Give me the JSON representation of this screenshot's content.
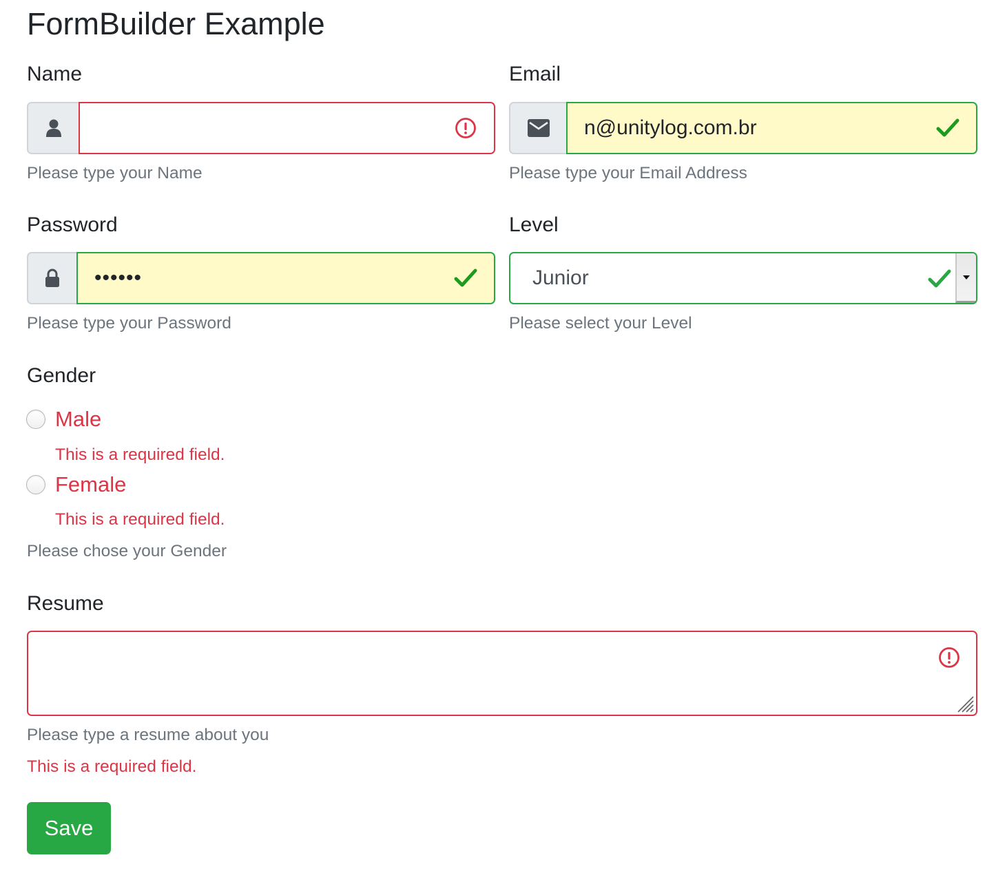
{
  "page": {
    "title": "FormBuilder Example"
  },
  "colors": {
    "valid": "#28a745",
    "invalid": "#dc3545",
    "valid_fill": "#fffac8",
    "help_text": "#6c757d",
    "primary_button": "#28a745"
  },
  "form": {
    "name": {
      "label": "Name",
      "value": "",
      "addon_icon": "user-icon",
      "status": "invalid",
      "status_icon": "exclamation-circle-icon",
      "help": "Please type your Name"
    },
    "email": {
      "label": "Email",
      "value": "n@unitylog.com.br",
      "addon_icon": "envelope-icon",
      "status": "valid",
      "status_icon": "check-icon",
      "help": "Please type your Email Address"
    },
    "password": {
      "label": "Password",
      "value": "••••••",
      "addon_icon": "lock-icon",
      "status": "valid",
      "status_icon": "check-icon",
      "help": "Please type your Password"
    },
    "level": {
      "label": "Level",
      "selected": "Junior",
      "status": "valid",
      "status_icon": "check-icon",
      "help": "Please select your Level"
    },
    "gender": {
      "label": "Gender",
      "options": [
        {
          "label": "Male",
          "checked": false,
          "error": "This is a required field."
        },
        {
          "label": "Female",
          "checked": false,
          "error": "This is a required field."
        }
      ],
      "help": "Please chose your Gender"
    },
    "resume": {
      "label": "Resume",
      "value": "",
      "status": "invalid",
      "status_icon": "exclamation-circle-icon",
      "help": "Please type a resume about you",
      "error": "This is a required field."
    },
    "save_label": "Save"
  }
}
